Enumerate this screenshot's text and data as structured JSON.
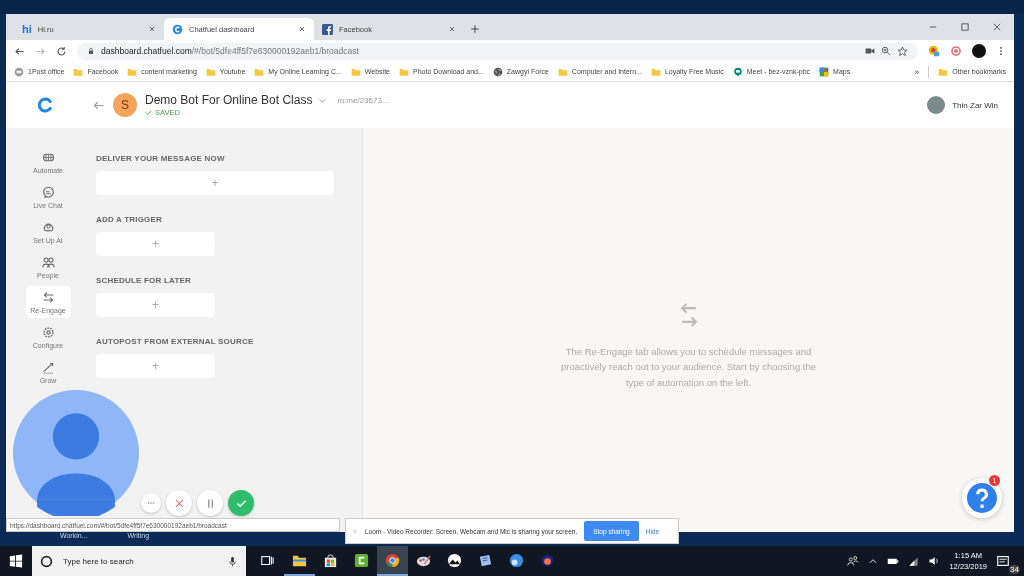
{
  "browser": {
    "tabs": [
      {
        "kind": "hi",
        "logo": "hi",
        "title": "Hi.ru",
        "selected": false
      },
      {
        "kind": "chatfuel",
        "title": "Chatfuel dashboard",
        "selected": true
      },
      {
        "kind": "facebook",
        "title": "Facebook",
        "selected": false
      }
    ],
    "address": {
      "host": "dashboard.chatfuel.com",
      "path": "/#/bot/5dfe4ff5f7e630000192aeb1/broadcast"
    },
    "bookmarks": [
      {
        "kind": "page",
        "label": "1Post office"
      },
      {
        "kind": "folder",
        "label": "Facebook"
      },
      {
        "kind": "folder",
        "label": "content marketing"
      },
      {
        "kind": "folder",
        "label": "Youtube"
      },
      {
        "kind": "folder",
        "label": "My Online Learning C..."
      },
      {
        "kind": "folder",
        "label": "Website"
      },
      {
        "kind": "folder",
        "label": "Photo Download and..."
      },
      {
        "kind": "globe",
        "label": "Zawgyi Force"
      },
      {
        "kind": "folder",
        "label": "Computer and Intern..."
      },
      {
        "kind": "folder",
        "label": "Loyalty Free Music"
      },
      {
        "kind": "meet",
        "label": "Meet - bez-vznk-pbc"
      },
      {
        "kind": "maps",
        "label": "Maps"
      }
    ],
    "overflow": "»",
    "other_bookmarks": "Other bookmarks",
    "status_url": "https://dashboard.chatfuel.com/#/bot/5dfe4ff5f7e630000192aeb1/broadcast"
  },
  "app": {
    "bot": {
      "avatar_letter": "S",
      "name": "Demo Bot For Online Bot Class",
      "status": "SAVED",
      "link": "m.me/23673..."
    },
    "user": {
      "name": "Thin Zar Win"
    },
    "nav": [
      {
        "kind": "automate",
        "label": "Automate",
        "selected": false
      },
      {
        "kind": "chat",
        "label": "Live Chat",
        "selected": false
      },
      {
        "kind": "ai",
        "label": "Set Up AI",
        "selected": false
      },
      {
        "kind": "people",
        "label": "People",
        "selected": false
      },
      {
        "kind": "reengage",
        "label": "Re-Engage",
        "selected": true
      },
      {
        "kind": "configure",
        "label": "Configure",
        "selected": false
      },
      {
        "kind": "grow",
        "label": "Grow",
        "selected": false
      }
    ],
    "sections": [
      {
        "heading": "DELIVER YOUR MESSAGE NOW",
        "kind": "wide",
        "add": "+"
      },
      {
        "heading": "ADD A TRIGGER",
        "kind": "narrow",
        "add": "+"
      },
      {
        "heading": "SCHEDULE FOR LATER",
        "kind": "narrow",
        "add": "+"
      },
      {
        "heading": "AUTOPOST FROM EXTERNAL SOURCE",
        "kind": "narrow",
        "add": "+"
      }
    ],
    "empty_text": "The Re-Engage tab allows you to schedule messages and proactively reach out to your audience. Start by choosing the type of automation on the left.",
    "help_badge": "1"
  },
  "loom": {
    "message": "Loom - Video Recorder: Screen, Webcam and Mic is sharing your screen.",
    "stop": "Stop sharing",
    "hide": "Hide"
  },
  "desktop": {
    "icon_labels": [
      "Workin...",
      "Writing"
    ]
  },
  "taskbar": {
    "search_placeholder": "Type here to search",
    "apps": [
      {
        "kind": "explorer",
        "selected": false,
        "running": true
      },
      {
        "kind": "store",
        "selected": false,
        "running": false
      },
      {
        "kind": "camtasia",
        "selected": false,
        "running": false
      },
      {
        "kind": "chrome",
        "selected": true,
        "running": true
      },
      {
        "kind": "paint",
        "selected": false,
        "running": false
      },
      {
        "kind": "photos",
        "selected": false,
        "running": false
      },
      {
        "kind": "notes",
        "selected": false,
        "running": false
      },
      {
        "kind": "edge",
        "selected": false,
        "running": false
      },
      {
        "kind": "game",
        "selected": false,
        "running": false
      }
    ],
    "time": "1:15 AM",
    "date": "12/23/2019",
    "notifications": "34"
  }
}
